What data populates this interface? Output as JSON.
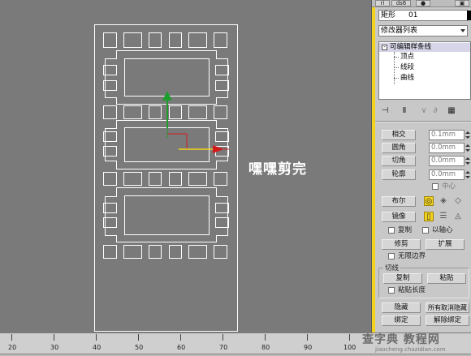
{
  "viewport": {
    "annotation_text": "嘿嘿剪完"
  },
  "top_strip": {
    "buttons": [
      "ri",
      "ds6",
      "●",
      "▣"
    ]
  },
  "panel": {
    "object_label": "矩形",
    "object_name": "01",
    "modifier_list": "修改器列表",
    "stack": {
      "root": "可编辑样条线",
      "minus": "-",
      "children": [
        "顶点",
        "线段",
        "曲线"
      ]
    },
    "rollout": {
      "buttons_with_values": [
        {
          "label": "相交",
          "value": "0.1mm"
        },
        {
          "label": "圆角",
          "value": "0.0mm"
        },
        {
          "label": "切角",
          "value": "0.0mm"
        },
        {
          "label": "轮廓",
          "value": "0.0mm"
        }
      ],
      "center_label": "中心",
      "boolean_label": "布尔",
      "mirror_label": "镜像",
      "copy_label": "复制",
      "about_pivot_label": "以轴心",
      "trim_label": "修剪",
      "extend_label": "扩展",
      "infinite_bounds_label": "无限边界",
      "tangent_group": "切线",
      "copy_btn": "复制",
      "paste_btn": "粘贴",
      "paste_length_label": "粘贴长度",
      "hide_btn": "隐藏",
      "unhide_all_btn": "所有取消隐藏",
      "bind_btn": "绑定",
      "unbind_btn": "解除绑定"
    }
  },
  "ruler": {
    "ticks": [
      "20",
      "30",
      "40",
      "50",
      "60",
      "70",
      "80",
      "90",
      "100"
    ]
  },
  "watermark": {
    "main": "查字典 教程网",
    "sub": "jiaocheng.chazidian.com"
  },
  "colors": {
    "viewport_bg": "#7a7a7a",
    "shape_line": "#ffffff",
    "gizmo_y": "#1f9c2e",
    "gizmo_x": "#d11b1b",
    "highlight": "#f2d21c"
  }
}
